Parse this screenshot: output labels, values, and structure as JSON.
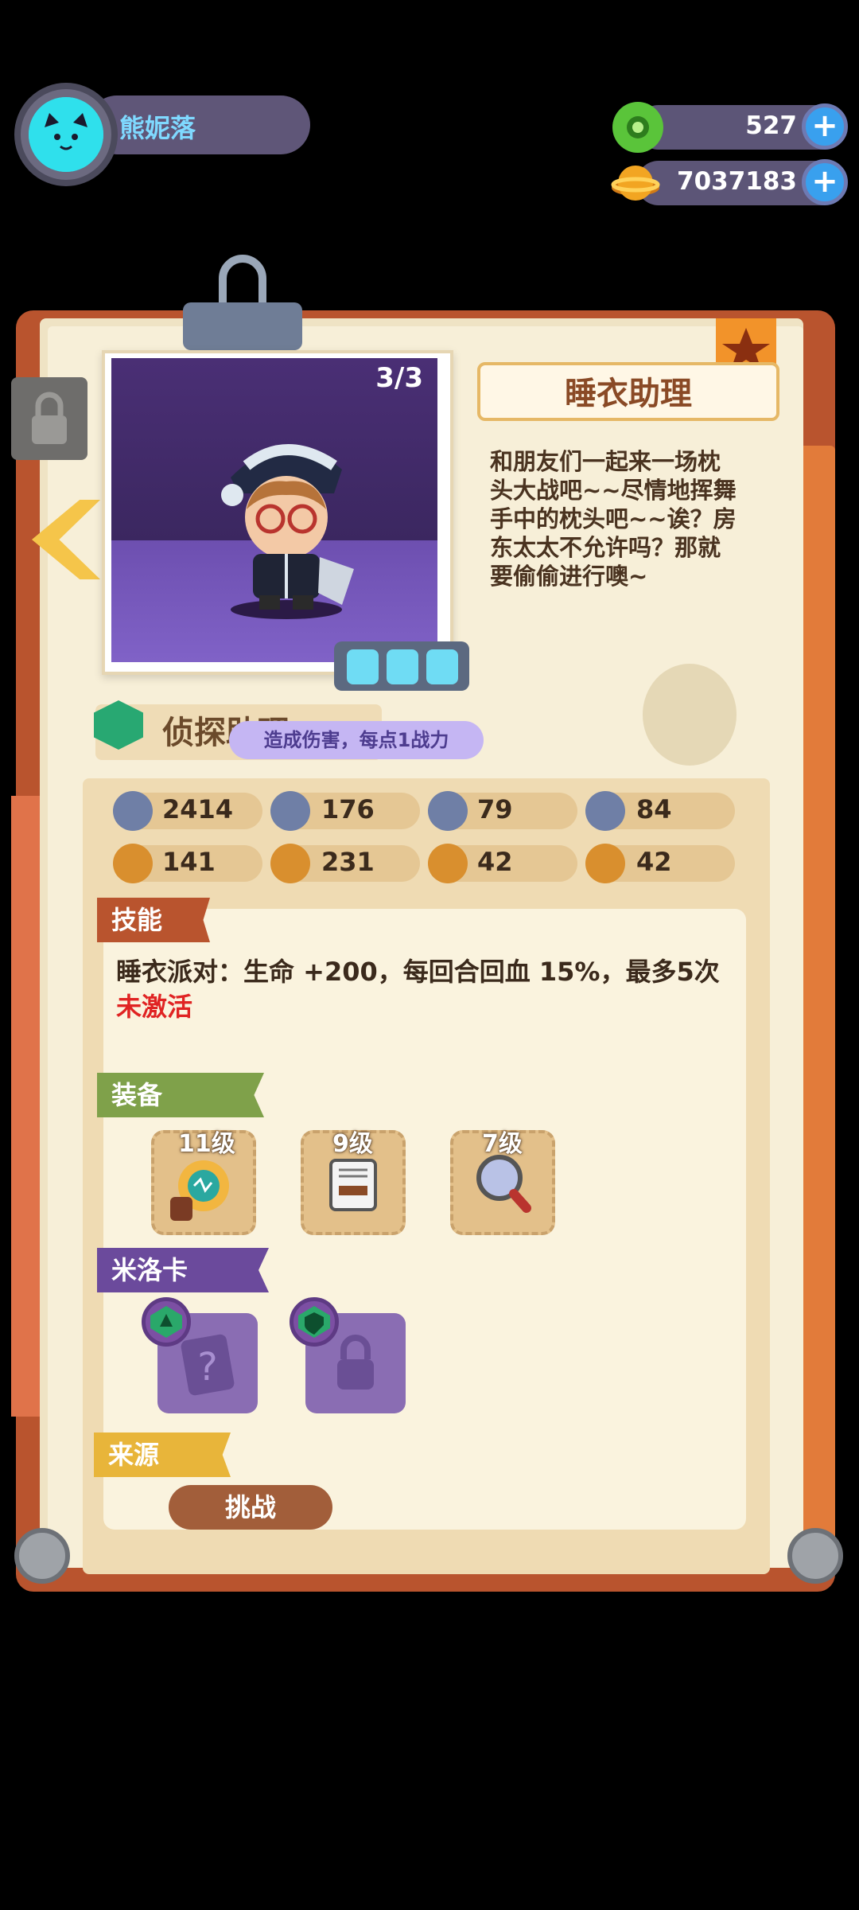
{
  "player": {
    "name": "熊妮落",
    "avatar_icon": "cat-face-icon"
  },
  "currencies": [
    {
      "name": "green-gem",
      "icon": "green-gem-icon",
      "value": "527",
      "color": "#5ac43a"
    },
    {
      "name": "gold-coin",
      "icon": "gold-coin-icon",
      "value": "7037183",
      "color": "#f2a522"
    }
  ],
  "character": {
    "count": "3/3",
    "name": "睡衣助理",
    "description": "和朋友们一起来一场枕\n头大战吧~~尽情地挥舞\n手中的枕头吧~~诶？房\n东太太不允许吗？那就\n要偷偷进行噢~",
    "class_label": "侦探助理",
    "tooltip": "造成伤害，每点1战力"
  },
  "stats": [
    {
      "icon": "heart-shield-icon",
      "value": "2414"
    },
    {
      "icon": "sword-icon",
      "value": "176"
    },
    {
      "icon": "shield-icon",
      "value": "79"
    },
    {
      "icon": "speed-icon",
      "value": "84"
    },
    {
      "icon": "fist-icon",
      "value": "141"
    },
    {
      "icon": "smile-icon",
      "value": "231"
    },
    {
      "icon": "muscle-icon",
      "value": "42"
    },
    {
      "icon": "brain-icon",
      "value": "42"
    }
  ],
  "skill": {
    "header": "技能",
    "text": "睡衣派对：生命 +200，每回合回血 15%，最多5次",
    "status": "未激活"
  },
  "equipment": {
    "header": "装备",
    "items": [
      {
        "level": "11级",
        "icon": "pocket-watch-icon"
      },
      {
        "level": "9级",
        "icon": "notebook-icon"
      },
      {
        "level": "7级",
        "icon": "magnifier-icon"
      }
    ]
  },
  "cards": {
    "header": "米洛卡",
    "slots": [
      {
        "state": "unknown",
        "icon": "question-mark-icon"
      },
      {
        "state": "locked",
        "icon": "lock-icon"
      }
    ]
  },
  "source": {
    "header": "来源",
    "button": "挑战"
  },
  "colors": {
    "board": "#b9542e",
    "paper": "#f7efd8",
    "accent_green": "#28a872",
    "status_red": "#e02323"
  }
}
